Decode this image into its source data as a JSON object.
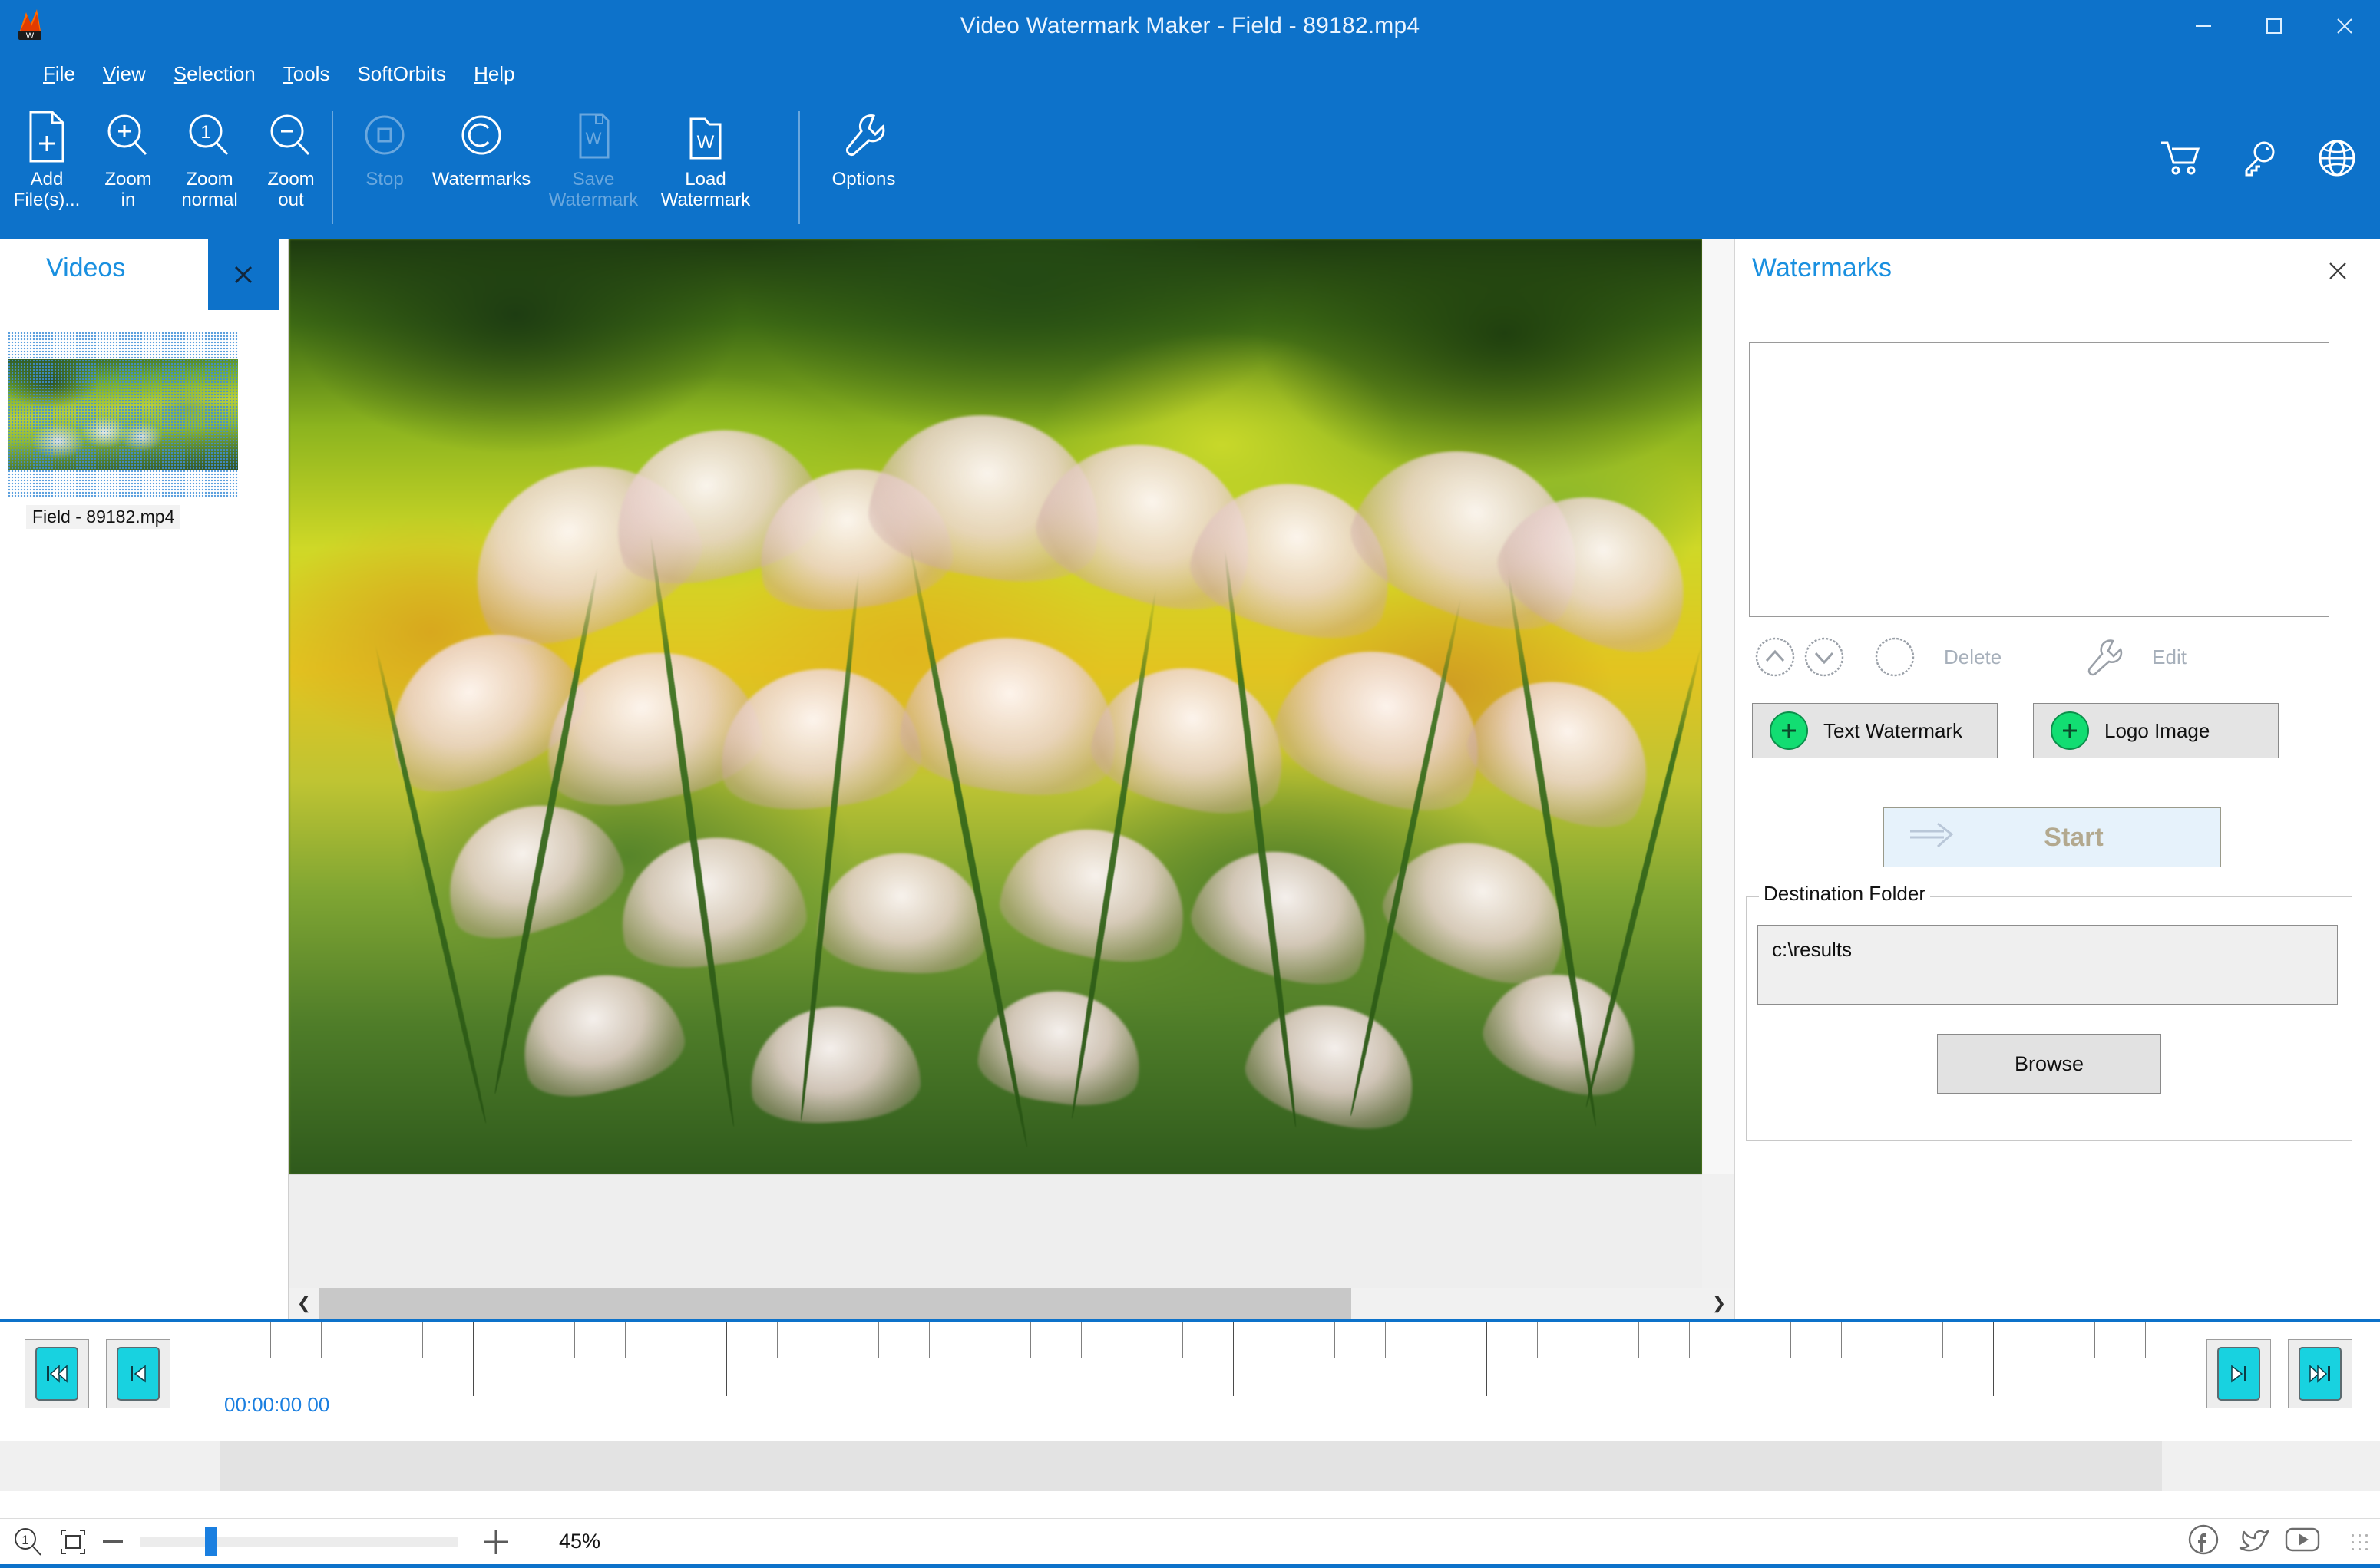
{
  "window": {
    "title": "Video Watermark Maker - Field - 89182.mp4",
    "logo_icon": "app-logo-icon",
    "controls": {
      "minimize": "minimize-icon",
      "maximize": "maximize-icon",
      "close": "close-icon"
    }
  },
  "menubar": {
    "items": [
      {
        "label": "File",
        "accel": "F"
      },
      {
        "label": "View",
        "accel": "V"
      },
      {
        "label": "Selection",
        "accel": "S"
      },
      {
        "label": "Tools",
        "accel": "T"
      },
      {
        "label": "SoftOrbits",
        "accel": ""
      },
      {
        "label": "Help",
        "accel": "H"
      }
    ]
  },
  "toolbar": {
    "buttons": [
      {
        "id": "add-files",
        "line1": "Add",
        "line2": "File(s)...",
        "icon": "add-file-icon",
        "enabled": true
      },
      {
        "id": "zoom-in",
        "line1": "Zoom",
        "line2": "in",
        "icon": "zoom-in-icon",
        "enabled": true
      },
      {
        "id": "zoom-normal",
        "line1": "Zoom",
        "line2": "normal",
        "icon": "zoom-normal-icon",
        "enabled": true
      },
      {
        "id": "zoom-out",
        "line1": "Zoom",
        "line2": "out",
        "icon": "zoom-out-icon",
        "enabled": true
      },
      {
        "id": "stop",
        "line1": "Stop",
        "line2": "",
        "icon": "stop-icon",
        "enabled": false
      },
      {
        "id": "watermarks",
        "line1": "Watermarks",
        "line2": "",
        "icon": "copyright-icon",
        "enabled": true
      },
      {
        "id": "save-watermark",
        "line1": "Save",
        "line2": "Watermark",
        "icon": "save-watermark-icon",
        "enabled": false
      },
      {
        "id": "load-watermark",
        "line1": "Load",
        "line2": "Watermark",
        "icon": "load-watermark-icon",
        "enabled": true
      },
      {
        "id": "options",
        "line1": "Options",
        "line2": "",
        "icon": "wrench-icon",
        "enabled": true
      }
    ],
    "right_icons": [
      {
        "id": "cart",
        "icon": "shopping-cart-icon"
      },
      {
        "id": "key",
        "icon": "key-icon"
      },
      {
        "id": "globe",
        "icon": "globe-icon"
      }
    ]
  },
  "videos_panel": {
    "title": "Videos",
    "close_icon": "close-icon",
    "items": [
      {
        "label": "Field - 89182.mp4",
        "selected": true
      }
    ]
  },
  "preview": {
    "scroll_h_left_icon": "chevron-left-icon",
    "scroll_h_right_icon": "chevron-right-icon"
  },
  "watermarks_panel": {
    "title": "Watermarks",
    "close_icon": "close-icon",
    "list_items": [],
    "tools": [
      {
        "id": "move-up",
        "icon": "chevron-up-circle-icon",
        "label": "",
        "enabled": false
      },
      {
        "id": "move-down",
        "icon": "chevron-down-circle-icon",
        "label": "",
        "enabled": false
      },
      {
        "id": "delete",
        "icon": "circle-icon",
        "label": "Delete",
        "enabled": false
      },
      {
        "id": "edit",
        "icon": "wrench-icon",
        "label": "Edit",
        "enabled": false
      }
    ],
    "add_buttons": [
      {
        "id": "text-watermark",
        "label": "Text Watermark",
        "icon": "plus-circle-icon"
      },
      {
        "id": "logo-image",
        "label": "Logo Image",
        "icon": "plus-circle-icon"
      }
    ],
    "start_button": {
      "label": "Start",
      "icon": "arrow-right-icon",
      "enabled": false
    },
    "destination": {
      "legend": "Destination Folder",
      "path": "c:\\results",
      "browse_label": "Browse"
    }
  },
  "timeline": {
    "nav_left": [
      {
        "id": "go-start",
        "icon": "skip-to-start-icon"
      },
      {
        "id": "prev-frame",
        "icon": "step-back-icon"
      }
    ],
    "nav_right": [
      {
        "id": "next-frame",
        "icon": "step-forward-icon"
      },
      {
        "id": "go-end",
        "icon": "skip-to-end-icon"
      }
    ],
    "timecode": "00:00:00 00",
    "minor_tick_count": 40,
    "major_tick_every": 5
  },
  "statusbar": {
    "zoom_normal_icon": "zoom-one-icon",
    "fit_icon": "fit-to-window-icon",
    "minus_icon": "minus-icon",
    "plus_icon": "plus-icon",
    "zoom_percent": "45%",
    "zoom_value": 45,
    "social": [
      {
        "id": "facebook",
        "icon": "facebook-icon"
      },
      {
        "id": "twitter",
        "icon": "twitter-icon"
      },
      {
        "id": "youtube",
        "icon": "youtube-icon"
      }
    ],
    "grip_icon": "resize-grip-icon"
  },
  "colors": {
    "accent": "#0d72ca",
    "panel_title": "#1a90e0",
    "green_plus": "#12dd72",
    "cyan_button": "#18d2e0",
    "timecode": "#1a7fe0"
  }
}
